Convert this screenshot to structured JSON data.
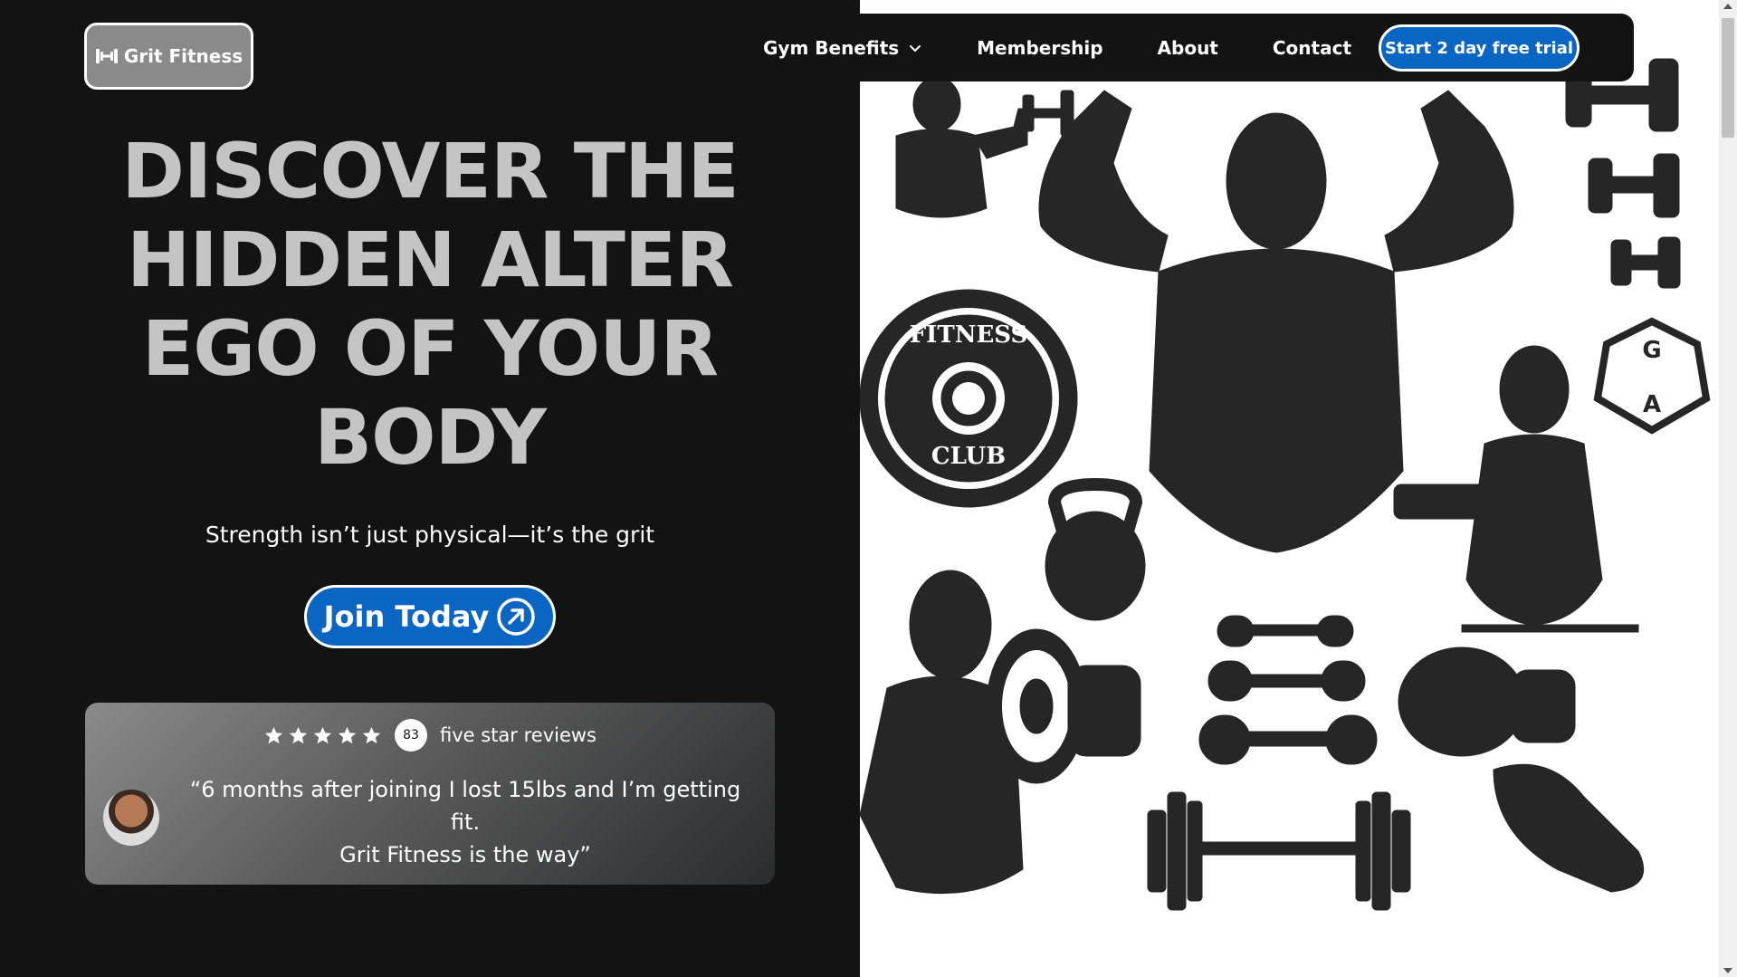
{
  "brand": {
    "logo_text": "Grit Fitness",
    "logo_icon": "dumbbell-icon"
  },
  "nav": {
    "items": [
      {
        "label": "Gym Benefits",
        "has_dropdown": true
      },
      {
        "label": "Membership"
      },
      {
        "label": "About"
      },
      {
        "label": "Contact"
      }
    ],
    "cta_label": "Start 2 day free trial"
  },
  "hero": {
    "headline_lines": [
      "DISCOVER THE",
      "HIDDEN ALTER",
      "EGO OF YOUR",
      "BODY"
    ],
    "subtitle": "Strength isn’t just physical—it’s the grit",
    "join_label": "Join Today",
    "join_icon": "arrow-up-right-circle-icon"
  },
  "review": {
    "stars": 5,
    "count": "83",
    "label": "five star reviews",
    "quote_line1": "“6 months after joining I lost 15lbs and I’m getting fit.",
    "quote_line2": "Grit Fitness is the way”"
  },
  "illustration": {
    "plate_top_text": "FITNESS",
    "plate_bottom_text": "CLUB",
    "badge_letters": [
      "G",
      "A"
    ]
  },
  "colors": {
    "background": "#131313",
    "accent_blue": "#0a66c2",
    "headline_gray": "#c4c4c4",
    "white": "#ffffff"
  }
}
